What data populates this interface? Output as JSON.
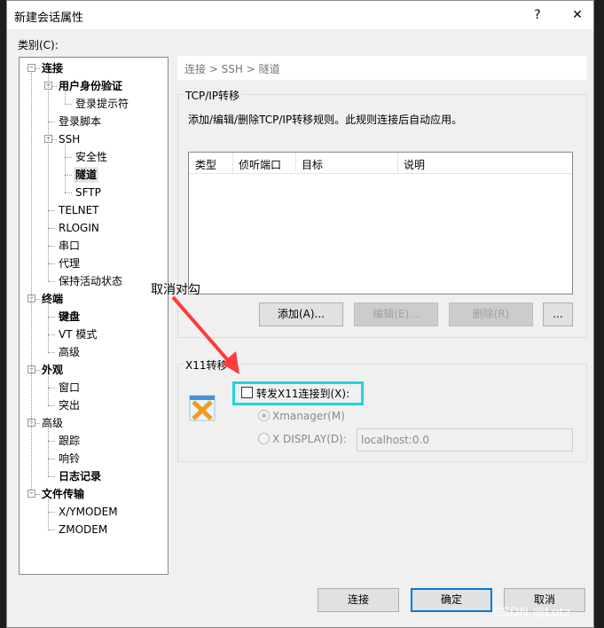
{
  "window": {
    "title": "新建会话属性",
    "help": "?",
    "close": "✕"
  },
  "category_label": "类别(C):",
  "tree": [
    {
      "label": "连接",
      "level": 0,
      "bold": true,
      "expand": true
    },
    {
      "label": "用户身份验证",
      "level": 1,
      "bold": true,
      "expand": true
    },
    {
      "label": "登录提示符",
      "level": 2
    },
    {
      "label": "登录脚本",
      "level": 1
    },
    {
      "label": "SSH",
      "level": 1,
      "expand": true
    },
    {
      "label": "安全性",
      "level": 2
    },
    {
      "label": "隧道",
      "level": 2,
      "bold": true,
      "selected": true
    },
    {
      "label": "SFTP",
      "level": 2
    },
    {
      "label": "TELNET",
      "level": 1
    },
    {
      "label": "RLOGIN",
      "level": 1
    },
    {
      "label": "串口",
      "level": 1
    },
    {
      "label": "代理",
      "level": 1
    },
    {
      "label": "保持活动状态",
      "level": 1
    },
    {
      "label": "终端",
      "level": 0,
      "bold": true,
      "expand": true
    },
    {
      "label": "键盘",
      "level": 1,
      "bold": true
    },
    {
      "label": "VT 模式",
      "level": 1
    },
    {
      "label": "高级",
      "level": 1
    },
    {
      "label": "外观",
      "level": 0,
      "bold": true,
      "expand": true
    },
    {
      "label": "窗口",
      "level": 1
    },
    {
      "label": "突出",
      "level": 1
    },
    {
      "label": "高级",
      "level": 0,
      "expand": true
    },
    {
      "label": "跟踪",
      "level": 1
    },
    {
      "label": "响铃",
      "level": 1
    },
    {
      "label": "日志记录",
      "level": 1,
      "bold": true
    },
    {
      "label": "文件传输",
      "level": 0,
      "bold": true,
      "expand": true
    },
    {
      "label": "X/YMODEM",
      "level": 1
    },
    {
      "label": "ZMODEM",
      "level": 1
    }
  ],
  "breadcrumb": "连接 > SSH > 隧道",
  "tcp": {
    "title": "TCP/IP转移",
    "desc": "添加/编辑/删除TCP/IP转移规则。此规则连接后自动应用。",
    "columns": [
      "类型",
      "侦听端口",
      "目标",
      "说明"
    ],
    "buttons": {
      "add": "添加(A)...",
      "edit": "编辑(E)...",
      "delete": "删除(R)",
      "more": "..."
    }
  },
  "x11": {
    "title": "X11转移",
    "forward_label": "转发X11连接到(X):",
    "forward_checked": false,
    "xmanager": "Xmanager(M)",
    "xdisplay": "X DISPLAY(D):",
    "display_value": "localhost:0.0"
  },
  "footer": {
    "connect": "连接",
    "ok": "确定",
    "cancel": "取消"
  },
  "annotation": {
    "text": "取消对勾",
    "color": "#ff3b3b",
    "box_color": "#1ed6d6"
  },
  "watermark": "CSDN @Lotz"
}
